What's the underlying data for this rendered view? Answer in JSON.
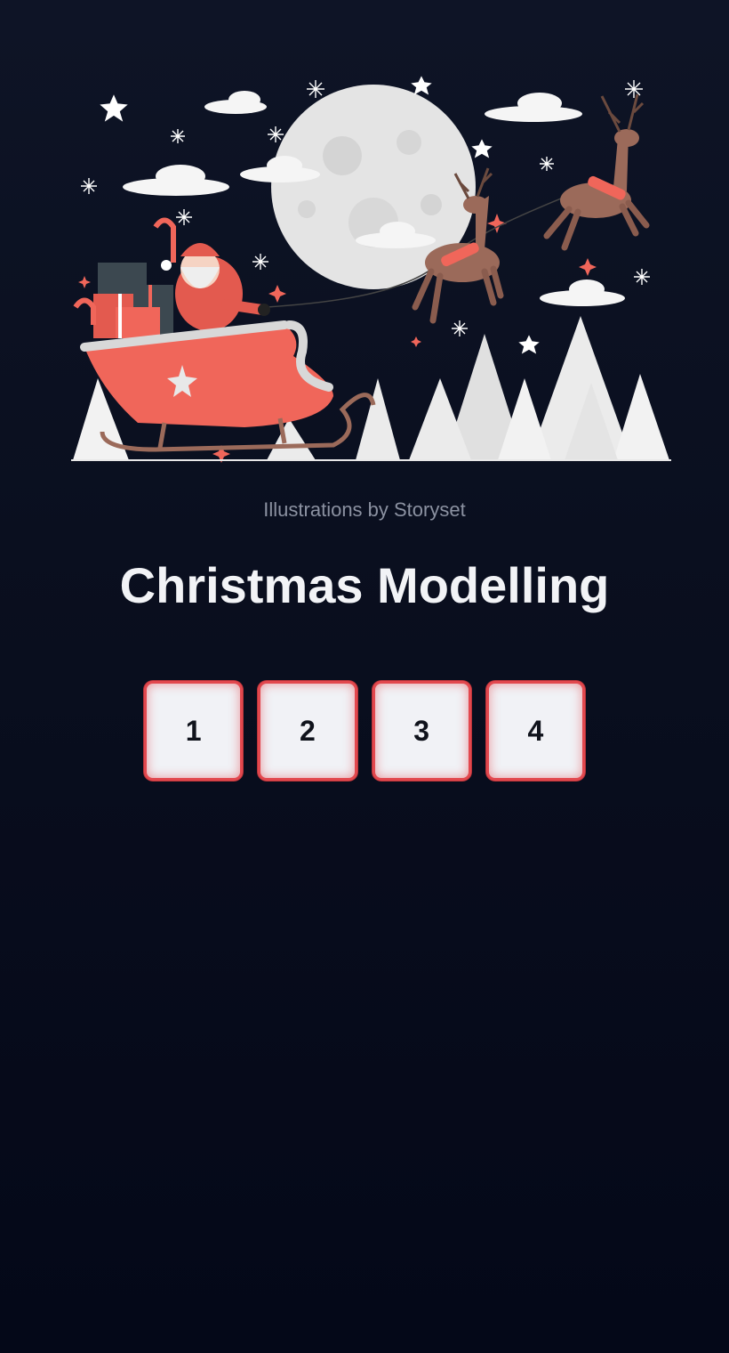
{
  "illustration": {
    "scene": "santa-sleigh-reindeer-night",
    "colors": {
      "moon": "#e4e4e4",
      "sleigh": "#f0665a",
      "reindeer": "#9b6a5a",
      "trees": "#ebebeb",
      "sparkle": "#f0665a"
    }
  },
  "credit": "Illustrations by Storyset",
  "title": "Christmas Modelling",
  "buttons": [
    {
      "label": "1"
    },
    {
      "label": "2"
    },
    {
      "label": "3"
    },
    {
      "label": "4"
    }
  ],
  "colors": {
    "accent_border": "#e2484e",
    "button_bg": "#f1f2f6",
    "background": "#0a0f1f"
  }
}
